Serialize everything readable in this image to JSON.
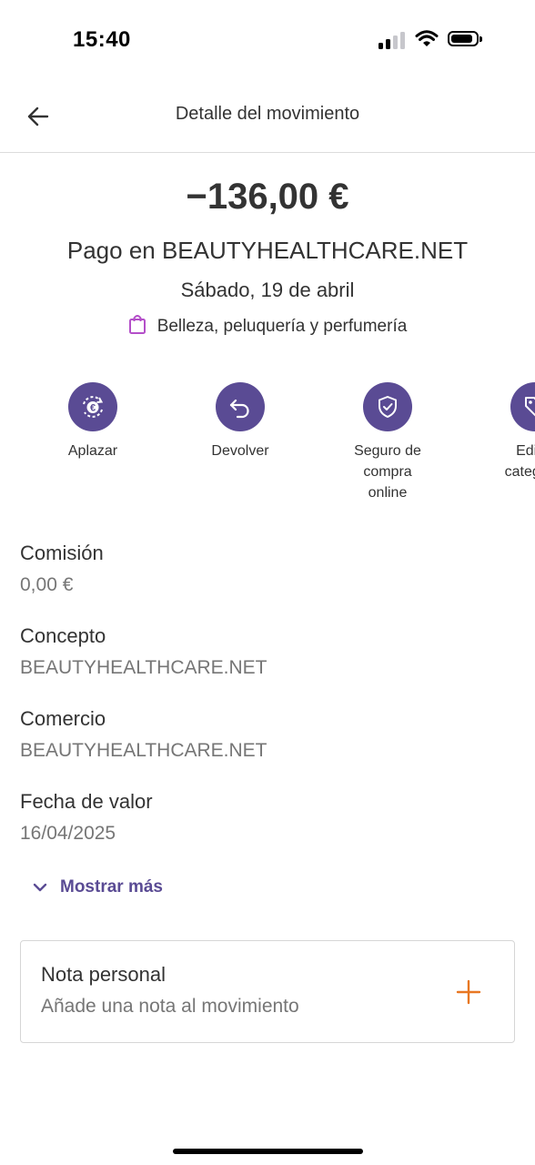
{
  "status_bar": {
    "time": "15:40"
  },
  "nav": {
    "title": "Detalle del movimiento",
    "back_icon": "arrow-left-icon"
  },
  "transaction": {
    "amount": "−136,00 €",
    "merchant_line": "Pago en BEAUTYHEALTHCARE.NET",
    "date": "Sábado, 19 de abril",
    "category": "Belleza, peluquería y perfumería",
    "category_icon": "shopping-bag-icon"
  },
  "actions": [
    {
      "label": "Aplazar",
      "icon": "euro-cycle-icon"
    },
    {
      "label": "Devolver",
      "icon": "return-arrow-icon"
    },
    {
      "label": "Seguro de compra online",
      "icon": "shield-check-icon"
    },
    {
      "label": "Editar categoría",
      "icon": "tag-icon"
    }
  ],
  "details": [
    {
      "key": "Comisión",
      "value": "0,00 €"
    },
    {
      "key": "Concepto",
      "value": "BEAUTYHEALTHCARE.NET"
    },
    {
      "key": "Comercio",
      "value": "BEAUTYHEALTHCARE.NET"
    },
    {
      "key": "Fecha de valor",
      "value": "16/04/2025"
    }
  ],
  "show_more": "Mostrar más",
  "note": {
    "title": "Nota personal",
    "placeholder": "Añade una nota al movimiento"
  },
  "colors": {
    "accent": "#5a4b94",
    "orange": "#e87722",
    "category_icon": "#b44fc9"
  }
}
